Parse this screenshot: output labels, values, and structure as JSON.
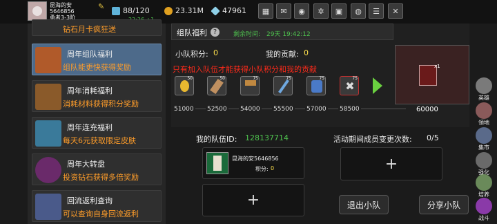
{
  "player": {
    "name": "昆海的安",
    "id": "5646856",
    "rank": "勇者3-3阶",
    "time": "22:26 +1"
  },
  "resources": {
    "stamina": "88/120",
    "gold": "23.31M",
    "gems": "47961"
  },
  "left_menu": [
    {
      "title": "",
      "desc": "钻石月卡疯狂送"
    },
    {
      "title": "周年组队福利",
      "desc": "组队能更快获得奖励"
    },
    {
      "title": "周年消耗福利",
      "desc": "消耗材料获得积分奖励"
    },
    {
      "title": "周年连充福利",
      "desc": "每天6元获取限定皮肤"
    },
    {
      "title": "周年大转盘",
      "desc": "投资钻石获得多倍奖励"
    },
    {
      "title": "回流返利查询",
      "desc": "可以查询自身回流返利"
    }
  ],
  "team": {
    "title": "组队福利",
    "countdown_label": "剩余时间:",
    "countdown_value": "29天 19:42:12",
    "team_points_label": "小队积分:",
    "team_points_value": "0",
    "my_contrib_label": "我的贡献:",
    "my_contrib_value": "0",
    "notice": "只有加入队伍才能获得小队积分和我的贡献",
    "reward_counts": [
      "50",
      "50",
      "75",
      "75",
      "75",
      "75"
    ],
    "milestones": [
      "51000",
      "52500",
      "54000",
      "55500",
      "57000",
      "58500",
      "60000"
    ],
    "preview_count": "x1"
  },
  "my_team": {
    "id_label": "我的队伍ID:",
    "id_value": "128137714",
    "member_name": "昆海的安5646856",
    "member_points_label": "积分:",
    "member_points_value": "0",
    "change_label": "活动期间成员变更次数:",
    "change_value": "0/5",
    "leave_button": "退出小队",
    "share_button": "分享小队",
    "plus": "+"
  },
  "right_side": [
    {
      "label": "英雄",
      "color": "#7a7a7a"
    },
    {
      "label": "领地",
      "color": "#8a5a5a"
    },
    {
      "label": "集市",
      "color": "#5a6a8a"
    },
    {
      "label": "强化",
      "color": "#6a6a6a"
    },
    {
      "label": "培养",
      "color": "#6a8a5a"
    },
    {
      "label": "战斗",
      "color": "#8a3aa8"
    }
  ],
  "colors": {
    "accent_green": "#4ec24e",
    "notice_red": "#ff2a1a",
    "desc_orange": "#ff9d2a",
    "selected_item": "#4d6a8a"
  }
}
